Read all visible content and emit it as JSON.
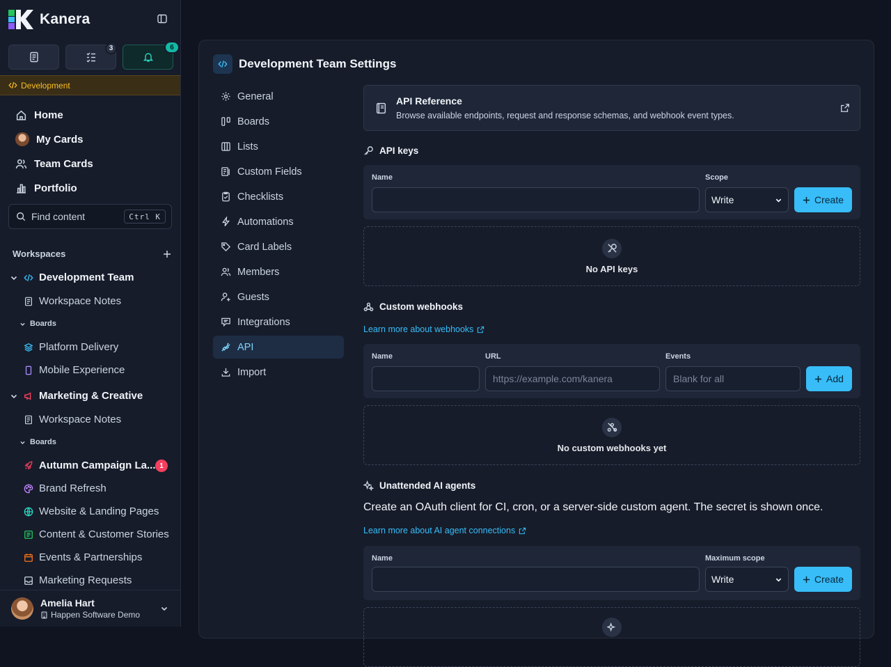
{
  "app": {
    "name": "Kanera",
    "context_label": "Development"
  },
  "toolbar": {
    "checklist_badge": "3",
    "notifications_badge": "6"
  },
  "nav": {
    "home": "Home",
    "my_cards": "My Cards",
    "team_cards": "Team Cards",
    "portfolio": "Portfolio"
  },
  "search": {
    "placeholder": "Find content",
    "shortcut": "Ctrl K"
  },
  "workspaces": {
    "heading": "Workspaces",
    "dev": {
      "name": "Development Team",
      "notes": "Workspace Notes",
      "boards_label": "Boards",
      "boards": [
        "Platform Delivery",
        "Mobile Experience"
      ]
    },
    "marketing": {
      "name": "Marketing & Creative",
      "notes": "Workspace Notes",
      "boards_label": "Boards",
      "boards": [
        "Autumn Campaign La...",
        "Brand Refresh",
        "Website & Landing Pages",
        "Content & Customer Stories",
        "Events & Partnerships",
        "Marketing Requests"
      ],
      "first_board_badge": "1"
    }
  },
  "user": {
    "name": "Amelia Hart",
    "org": "Happen Software Demo"
  },
  "settings": {
    "title": "Development Team Settings",
    "nav": [
      "General",
      "Boards",
      "Lists",
      "Custom Fields",
      "Checklists",
      "Automations",
      "Card Labels",
      "Members",
      "Guests",
      "Integrations",
      "API",
      "Import"
    ],
    "active_nav": "API"
  },
  "api_reference": {
    "title": "API Reference",
    "description": "Browse available endpoints, request and response schemas, and webhook event types."
  },
  "api_keys": {
    "title": "API keys",
    "name_label": "Name",
    "scope_label": "Scope",
    "scope_value": "Write",
    "create_label": "Create",
    "empty": "No API keys"
  },
  "webhooks": {
    "title": "Custom webhooks",
    "learn_more": "Learn more about webhooks",
    "name_label": "Name",
    "url_label": "URL",
    "url_placeholder": "https://example.com/kanera",
    "events_label": "Events",
    "events_placeholder": "Blank for all",
    "add_label": "Add",
    "empty": "No custom webhooks yet"
  },
  "agents": {
    "title": "Unattended AI agents",
    "description": "Create an OAuth client for CI, cron, or a server-side custom agent. The secret is shown once.",
    "learn_more": "Learn more about AI agent connections",
    "name_label": "Name",
    "scope_label": "Maximum scope",
    "scope_value": "Write",
    "create_label": "Create"
  },
  "colors": {
    "accent": "#38bdf8",
    "warning": "#fbbf24",
    "badge_red": "#f43f5e",
    "teal": "#14b8a6"
  }
}
